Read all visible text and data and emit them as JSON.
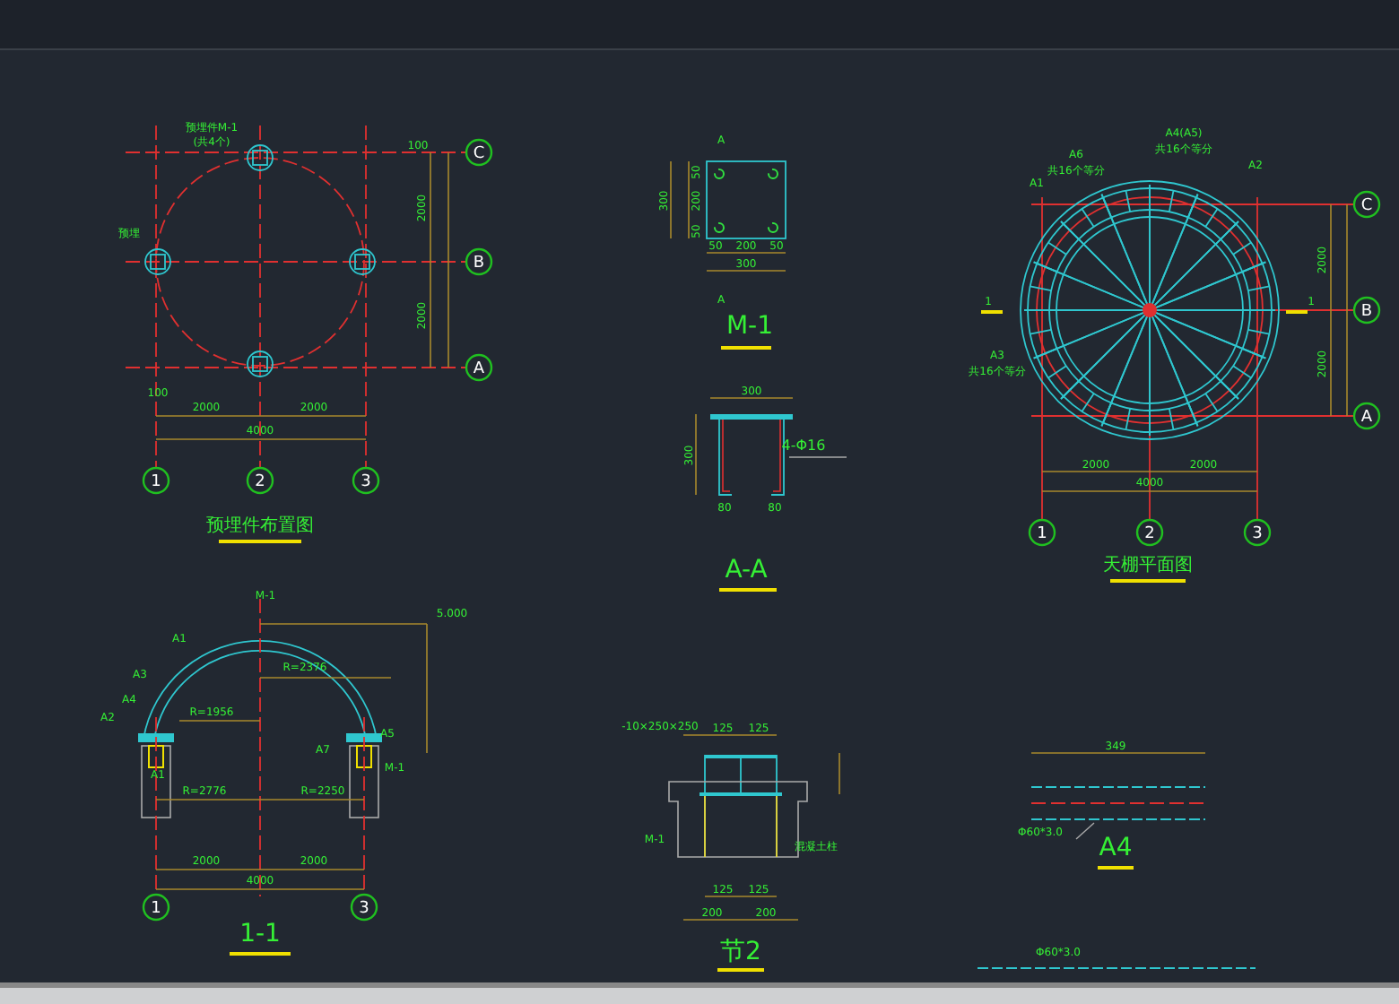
{
  "embed_plan": {
    "title": "预埋件布置图",
    "columns": [
      "1",
      "2",
      "3"
    ],
    "rows": [
      "C",
      "B",
      "A"
    ],
    "spans": [
      "2000",
      "2000"
    ],
    "total": "4000",
    "vspans": [
      "2000",
      "2000"
    ],
    "edges": [
      "100",
      "100"
    ],
    "callouts": [
      "预埋件M-1",
      "(共4个)",
      "预埋"
    ]
  },
  "plate_m1": {
    "title": "M-1",
    "marks": [
      "A",
      "A"
    ],
    "left_dims": [
      "50",
      "200",
      "50"
    ],
    "left_total": "300",
    "bottom_dims": [
      "50",
      "200",
      "50"
    ],
    "bottom_total": "300"
  },
  "section_aa": {
    "title": "A-A",
    "top_dim": "300",
    "left_dim": "300",
    "rebar": "4-Φ16",
    "bottom_dims": [
      "80",
      "80"
    ]
  },
  "canopy_plan": {
    "title": "天棚平面图",
    "columns": [
      "1",
      "2",
      "3"
    ],
    "rows": [
      "C",
      "B",
      "A"
    ],
    "spans": [
      "2000",
      "2000"
    ],
    "total": "4000",
    "vspans": [
      "2000",
      "2000"
    ],
    "section_marks": [
      "1",
      "1"
    ],
    "callouts": [
      "A6",
      "共16个等分",
      "A4(A5)",
      "共16个等分",
      "A2",
      "A1",
      "A3",
      "共16个等分"
    ]
  },
  "section_11": {
    "title": "1-1",
    "columns": [
      "1",
      "3"
    ],
    "spans": [
      "2000",
      "2000"
    ],
    "total": "4000",
    "elevation": "5.000",
    "radii": [
      "R=2376",
      "R=1956",
      "R=2776",
      "R=2250"
    ],
    "callouts": [
      "A1",
      "M-1",
      "A3",
      "A4",
      "A2",
      "A1",
      "A7",
      "A5",
      "M-1"
    ]
  },
  "node_2": {
    "title": "节2",
    "plate": "-10×250×250",
    "top_dims": [
      "125",
      "125"
    ],
    "column_label": "混凝土柱",
    "plate_label": "M-1",
    "bottom_dims": [
      "125",
      "125"
    ],
    "base_dims": [
      "200",
      "200"
    ]
  },
  "detail_a4": {
    "title": "A4",
    "length": "349",
    "pipe": "Φ60*3.0"
  },
  "bottom_strip": {
    "pipe": "Φ60*3.0"
  }
}
